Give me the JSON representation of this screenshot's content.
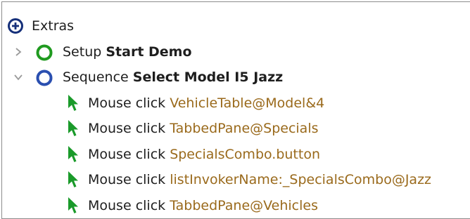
{
  "tree": {
    "root": {
      "label": "Extras",
      "icon": "plus-circle-icon"
    },
    "setup": {
      "type_label": "Setup",
      "name": "Start Demo",
      "expanded": false,
      "icon": "green-ring-icon",
      "color": "#1f9a1f"
    },
    "sequence": {
      "type_label": "Sequence",
      "name": "Select Model I5 Jazz",
      "expanded": true,
      "icon": "blue-ring-icon",
      "color": "#2a4fb0"
    },
    "steps": [
      {
        "action": "Mouse click",
        "target": "VehicleTable@Model&4",
        "icon": "mouse-cursor-icon"
      },
      {
        "action": "Mouse click",
        "target": "TabbedPane@Specials",
        "icon": "mouse-cursor-icon"
      },
      {
        "action": "Mouse click",
        "target": "SpecialsCombo.button",
        "icon": "mouse-cursor-icon"
      },
      {
        "action": "Mouse click",
        "target": "listInvokerName:_SpecialsCombo@Jazz",
        "icon": "mouse-cursor-icon"
      },
      {
        "action": "Mouse click",
        "target": "TabbedPane@Vehicles",
        "icon": "mouse-cursor-icon"
      }
    ]
  },
  "colors": {
    "argument_text": "#9a6a1c",
    "cursor_green": "#1a9a2a",
    "toggle_gray": "#9a9a9a"
  }
}
